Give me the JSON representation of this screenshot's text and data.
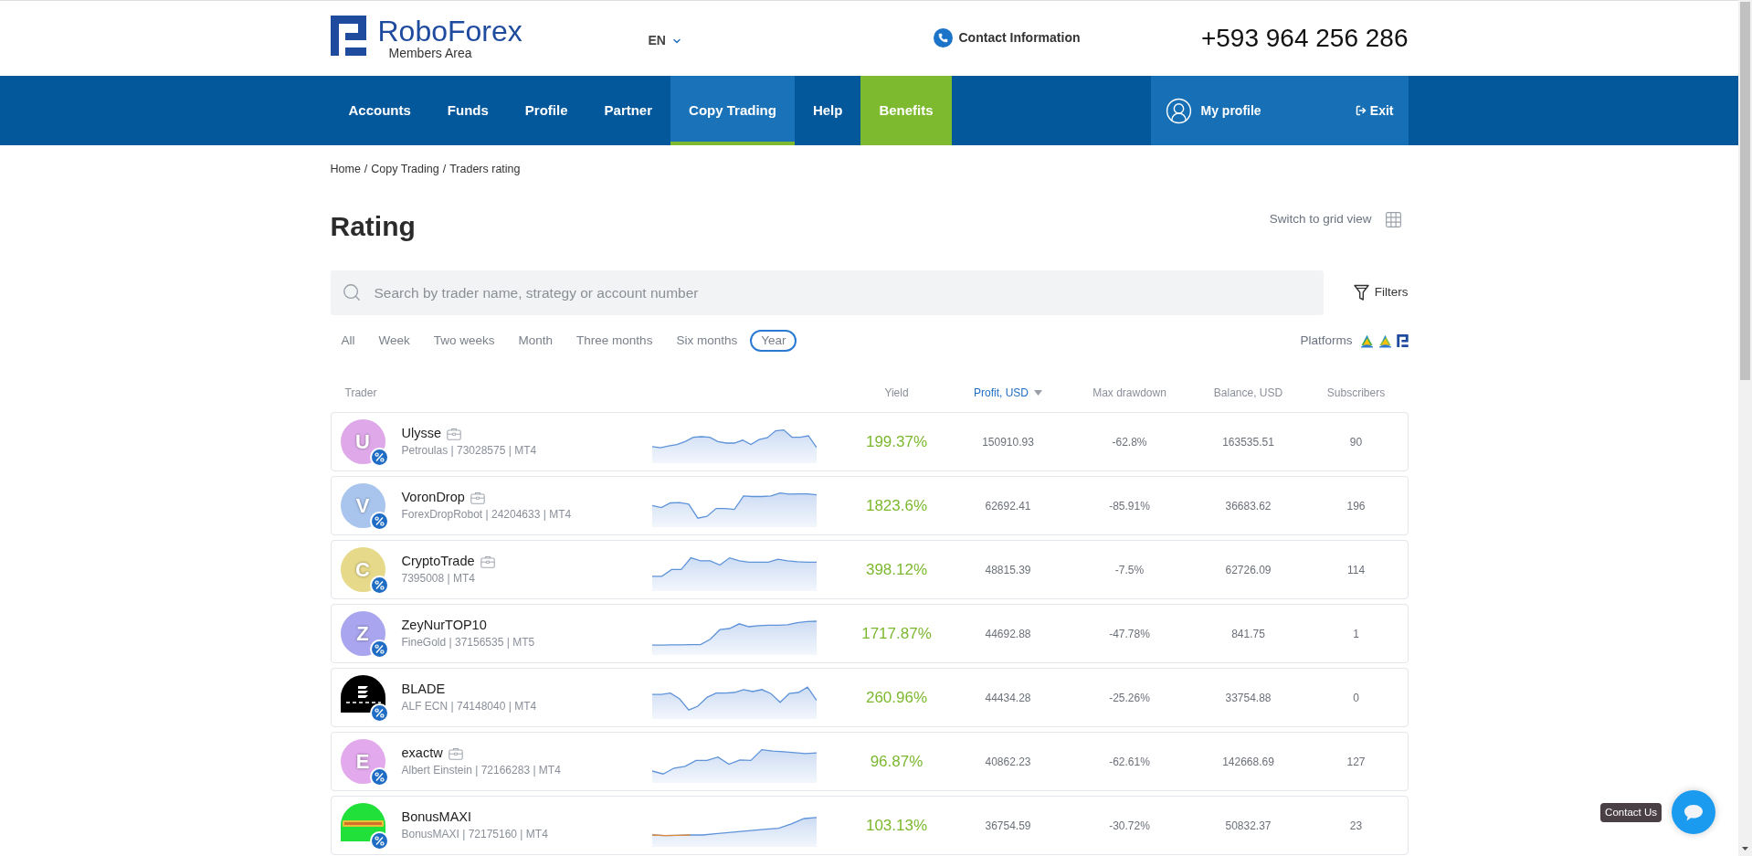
{
  "header": {
    "logo_text": "RoboForex",
    "logo_subtitle": "Members Area",
    "language": "EN",
    "contact_link": "Contact Information",
    "phone": "+593 964 256 286"
  },
  "nav": {
    "items": [
      {
        "label": "Accounts",
        "kind": "regular",
        "selected": false
      },
      {
        "label": "Funds",
        "kind": "regular",
        "selected": false
      },
      {
        "label": "Profile",
        "kind": "regular",
        "selected": false
      },
      {
        "label": "Partner",
        "kind": "regular",
        "selected": false
      },
      {
        "label": "Copy Trading",
        "kind": "regular",
        "selected": true
      },
      {
        "label": "Help",
        "kind": "regular",
        "selected": false
      },
      {
        "label": "Benefits",
        "kind": "promo",
        "selected": false
      }
    ],
    "profile": "My profile",
    "exit": "Exit"
  },
  "breadcrumb": {
    "items": [
      "Home",
      "Copy Trading",
      "Traders rating"
    ],
    "separator": "/"
  },
  "page_title": "Rating",
  "view_switch": "Switch to grid view",
  "search": {
    "placeholder": "Search by trader name, strategy or account number"
  },
  "filters": "Filters",
  "periods": [
    {
      "label": "All",
      "selected": false
    },
    {
      "label": "Week",
      "selected": false
    },
    {
      "label": "Two weeks",
      "selected": false
    },
    {
      "label": "Month",
      "selected": false
    },
    {
      "label": "Three months",
      "selected": false
    },
    {
      "label": "Six months",
      "selected": false
    },
    {
      "label": "Year",
      "selected": true
    }
  ],
  "platforms": {
    "label": "Platforms"
  },
  "table": {
    "columns": [
      {
        "label": "Trader",
        "sorted": false
      },
      {
        "label": "Yield",
        "sorted": false
      },
      {
        "label": "Profit, USD",
        "sorted": true
      },
      {
        "label": "Max drawdown",
        "sorted": false
      },
      {
        "label": "Balance, USD",
        "sorted": false
      },
      {
        "label": "Subscribers",
        "sorted": false
      }
    ],
    "rows": [
      {
        "avatar": {
          "kind": "letter",
          "letter": "U",
          "color": "#dfa9e9"
        },
        "name": "Ulysse",
        "briefcase": true,
        "details": "Petroulas | 73028575 | MT4",
        "yield": "199.37%",
        "profit": "150910.93",
        "max_drawdown": "-62.8%",
        "balance": "163535.51",
        "subscribers": "90"
      },
      {
        "avatar": {
          "kind": "letter",
          "letter": "V",
          "color": "#a9c5ee"
        },
        "name": "VoronDrop",
        "briefcase": true,
        "details": "ForexDropRobot | 24204633 | MT4",
        "yield": "1823.6%",
        "profit": "62692.41",
        "max_drawdown": "-85.91%",
        "balance": "36683.62",
        "subscribers": "196"
      },
      {
        "avatar": {
          "kind": "letter",
          "letter": "C",
          "color": "#e6d98a"
        },
        "name": "CryptoTrade",
        "briefcase": true,
        "details": "7395008 | MT4",
        "yield": "398.12%",
        "profit": "48815.39",
        "max_drawdown": "-7.5%",
        "balance": "62726.09",
        "subscribers": "114"
      },
      {
        "avatar": {
          "kind": "letter",
          "letter": "Z",
          "color": "#a9a5ee"
        },
        "name": "ZeyNurTOP10",
        "briefcase": false,
        "details": "FineGold | 37156535 | MT5",
        "yield": "1717.87%",
        "profit": "44692.88",
        "max_drawdown": "-47.78%",
        "balance": "841.75",
        "subscribers": "1"
      },
      {
        "avatar": {
          "kind": "logo_mark",
          "color": "#000000"
        },
        "name": "BLADE",
        "briefcase": false,
        "details": "ALF ECN | 74148040 | MT4",
        "yield": "260.96%",
        "profit": "44434.28",
        "max_drawdown": "-25.26%",
        "balance": "33754.88",
        "subscribers": "0"
      },
      {
        "avatar": {
          "kind": "letter",
          "letter": "E",
          "color": "#e2a9ec"
        },
        "name": "exactw",
        "briefcase": true,
        "details": "Albert Einstein | 72166283 | MT4",
        "yield": "96.87%",
        "profit": "40862.23",
        "max_drawdown": "-62.61%",
        "balance": "142668.69",
        "subscribers": "127"
      },
      {
        "avatar": {
          "kind": "logo_banner",
          "color": "#22e03a"
        },
        "name": "BonusMAXI",
        "briefcase": false,
        "details": "BonusMAXI | 72175160 | MT4",
        "yield": "103.13%",
        "profit": "36754.59",
        "max_drawdown": "-30.72%",
        "balance": "50832.37",
        "subscribers": "23"
      }
    ]
  },
  "contact_widget": {
    "tooltip": "Contact Us"
  }
}
